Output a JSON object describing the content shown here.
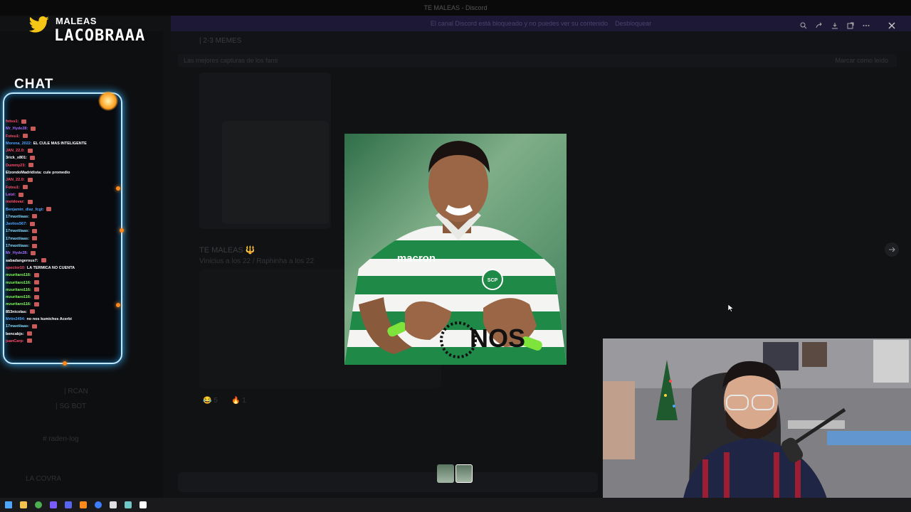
{
  "window": {
    "title": "TE MALEAS - Discord"
  },
  "banner": {
    "text": "El canal Discord está bloqueado y no puedes ver su contenido",
    "link": "Desbloquear"
  },
  "channel_header": {
    "name": "| 2-3 MEMES"
  },
  "pinned": {
    "text": "Las mejores capturas de los fans",
    "action": "Marcar como leído"
  },
  "background_message": {
    "author": "TE MALEAS 🔱",
    "text": "Vinicius a los 22 / Raphinha a los 22",
    "reactions": [
      "😂 5",
      "🔥 1"
    ]
  },
  "background_channels": [
    "| RCAN",
    "| SG BOT",
    "#  raden-log",
    "LA COVRA"
  ],
  "branding": {
    "handle_small": "MALEAS",
    "handle_large": "LACOBRAAA",
    "twitter_icon": "twitter-bird-icon"
  },
  "chat": {
    "title": "CHAT",
    "lines": [
      {
        "user": "fotsu1:",
        "color": "#ff4d6d",
        "msg": "",
        "emote": true
      },
      {
        "user": "Mr_Hyde28:",
        "color": "#a06bff",
        "msg": "",
        "emote": true
      },
      {
        "user": "Fotsu1:",
        "color": "#ff4d6d",
        "msg": "",
        "emote": true
      },
      {
        "user": "Morena_2022:",
        "color": "#4da6ff",
        "msg": "EL CULE MAS INTELIGENTE",
        "emote": false
      },
      {
        "user": "JAN_22.0:",
        "color": "#ff4d6d",
        "msg": "",
        "emote": true
      },
      {
        "user": "3rick_x801:",
        "color": "#ffffff",
        "msg": "",
        "emote": true
      },
      {
        "user": "Dummy23:",
        "color": "#ff4d6d",
        "msg": "",
        "emote": true
      },
      {
        "user": "ElzondoMadridista:",
        "color": "#ffffff",
        "msg": "cule promedio",
        "emote": false
      },
      {
        "user": "JAN_22.0:",
        "color": "#ff4d6d",
        "msg": "",
        "emote": true
      },
      {
        "user": "Fotsu1:",
        "color": "#ff4d6d",
        "msg": "",
        "emote": true
      },
      {
        "user": "Leizi:",
        "color": "#c56bff",
        "msg": "",
        "emote": true
      },
      {
        "user": "moldovar:",
        "color": "#ff4d6d",
        "msg": "",
        "emote": true
      },
      {
        "user": "Benjamin_diaz_fcgt:",
        "color": "#4da6ff",
        "msg": "",
        "emote": true
      },
      {
        "user": "17maxtiiaas:",
        "color": "#7fd8ff",
        "msg": "",
        "emote": true
      },
      {
        "user": "Javitos567:",
        "color": "#4da6ff",
        "msg": "",
        "emote": true
      },
      {
        "user": "17maxtiiaas:",
        "color": "#7fd8ff",
        "msg": "",
        "emote": true
      },
      {
        "user": "17maxtiiaas:",
        "color": "#7fd8ff",
        "msg": "",
        "emote": true
      },
      {
        "user": "17maxtiiaas:",
        "color": "#7fd8ff",
        "msg": "",
        "emote": true
      },
      {
        "user": "Mr_Hyde28:",
        "color": "#a06bff",
        "msg": "",
        "emote": true
      },
      {
        "user": "sabadangerous7:",
        "color": "#ffffff",
        "msg": "",
        "emote": true
      },
      {
        "user": "spector10:",
        "color": "#ff4d6d",
        "msg": "LA TERMICA NO CUENTA",
        "emote": false
      },
      {
        "user": "mzuritaro116:",
        "color": "#7dff5a",
        "msg": "",
        "emote": true
      },
      {
        "user": "mzuritaro116:",
        "color": "#7dff5a",
        "msg": "",
        "emote": true
      },
      {
        "user": "mzuritaro116:",
        "color": "#7dff5a",
        "msg": "",
        "emote": true
      },
      {
        "user": "mzuritaro116:",
        "color": "#7dff5a",
        "msg": "",
        "emote": true
      },
      {
        "user": "mzuritaro116:",
        "color": "#7dff5a",
        "msg": "",
        "emote": true
      },
      {
        "user": "853nicolas:",
        "color": "#ffffff",
        "msg": "",
        "emote": true
      },
      {
        "user": "Mrtin2494:",
        "color": "#4da6ff",
        "msg": "no nos kumiches Acerbi",
        "emote": false
      },
      {
        "user": "17maxtiiaas:",
        "color": "#7fd8ff",
        "msg": "",
        "emote": true
      },
      {
        "user": "bencabjs:",
        "color": "#ffffff",
        "msg": "",
        "emote": true
      },
      {
        "user": "juanCarp:",
        "color": "#ff4d6d",
        "msg": "",
        "emote": true
      }
    ]
  },
  "viewer": {
    "toolbar": [
      "zoom-icon",
      "share-icon",
      "download-icon",
      "open-external-icon",
      "more-icon"
    ],
    "jersey_brand": "macron",
    "jersey_crest": "SCP",
    "jersey_sponsor": "NOS"
  },
  "taskbar": {
    "icons": [
      {
        "name": "windows-start-icon",
        "color": "#4da6ff"
      },
      {
        "name": "file-explorer-icon",
        "color": "#f2c14e"
      },
      {
        "name": "chrome-icon",
        "color": "#4caf50"
      },
      {
        "name": "app-grid-icon",
        "color": "#7b5cff"
      },
      {
        "name": "discord-icon",
        "color": "#5865f2"
      },
      {
        "name": "streaming-app-icon",
        "color": "#ff8a1c"
      },
      {
        "name": "browser-icon",
        "color": "#3d7eff"
      },
      {
        "name": "obs-icon",
        "color": "#e0e0e0"
      },
      {
        "name": "app-icon",
        "color": "#6fc7c7"
      },
      {
        "name": "window-icon",
        "color": "#ffffff"
      }
    ]
  }
}
